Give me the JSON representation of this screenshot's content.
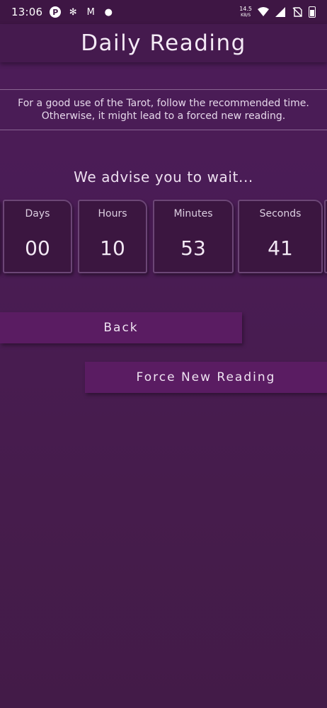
{
  "status_bar": {
    "time": "13:06",
    "left_icons": [
      "p-badge-icon",
      "fan-icon",
      "gmail-icon",
      "chat-bubble-icon"
    ],
    "net_speed_value": "14.5",
    "net_speed_unit": "KB/S",
    "right_icons": [
      "wifi-icon",
      "signal-icon",
      "no-sim-icon",
      "battery-icon"
    ]
  },
  "header": {
    "title": "Daily Reading"
  },
  "notice": {
    "text": "For a good use of the Tarot, follow the recommended time. Otherwise, it might lead to a forced new reading."
  },
  "countdown": {
    "heading": "We advise you to wait...",
    "units": [
      {
        "label": "Days",
        "value": "00"
      },
      {
        "label": "Hours",
        "value": "10"
      },
      {
        "label": "Minutes",
        "value": "53"
      },
      {
        "label": "Seconds",
        "value": "41"
      }
    ]
  },
  "actions": {
    "back_label": "Back",
    "force_label": "Force New Reading"
  },
  "colors": {
    "background": "#4a1c55",
    "header": "#451a4e",
    "card": "#3b1640",
    "card_border": "#6c4676",
    "button": "#5a1c62",
    "text": "#efe3f2"
  }
}
